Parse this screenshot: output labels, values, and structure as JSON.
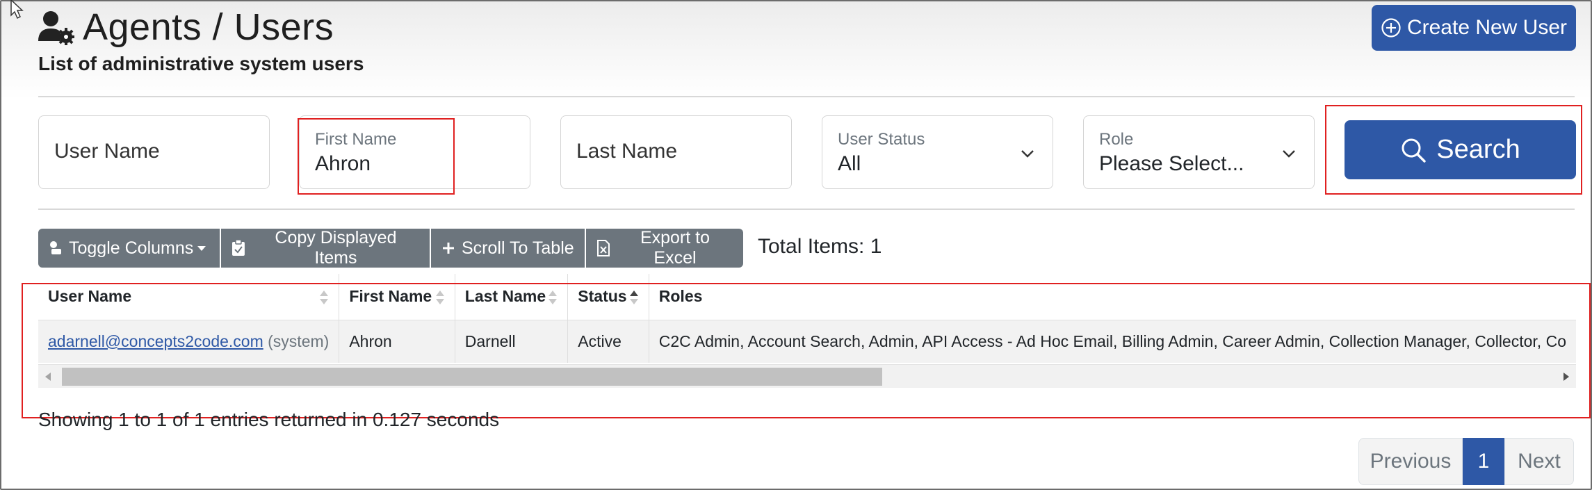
{
  "header": {
    "title": "Agents / Users",
    "subtitle": "List of administrative system users",
    "create_button": "Create New User"
  },
  "filters": {
    "user_name_placeholder": "User Name",
    "first_name_label": "First Name",
    "first_name_value": "Ahron",
    "last_name_placeholder": "Last Name",
    "user_status_label": "User Status",
    "user_status_value": "All",
    "role_label": "Role",
    "role_value": "Please Select...",
    "search_button": "Search"
  },
  "toolbar": {
    "toggle_columns": "Toggle Columns",
    "copy_displayed": "Copy Displayed Items",
    "scroll_to_table": "Scroll To Table",
    "export_excel": "Export to Excel",
    "total_items": "Total Items: 1"
  },
  "table": {
    "columns": [
      "User Name",
      "First Name",
      "Last Name",
      "Status",
      "Roles"
    ],
    "rows": [
      {
        "email": "adarnell@concepts2code.com",
        "tag": "(system)",
        "first_name": "Ahron",
        "last_name": "Darnell",
        "status": "Active",
        "roles": "C2C Admin, Account Search, Admin, API Access - Ad Hoc Email, Billing Admin, Career Admin, Collection Manager, Collector, Co"
      }
    ]
  },
  "footer": {
    "info": "Showing 1 to 1 of 1 entries returned in 0.127 seconds",
    "prev": "Previous",
    "page": "1",
    "next": "Next"
  },
  "colors": {
    "primary": "#2e58a6",
    "secondary": "#6c757d",
    "highlight": "#e02020"
  }
}
